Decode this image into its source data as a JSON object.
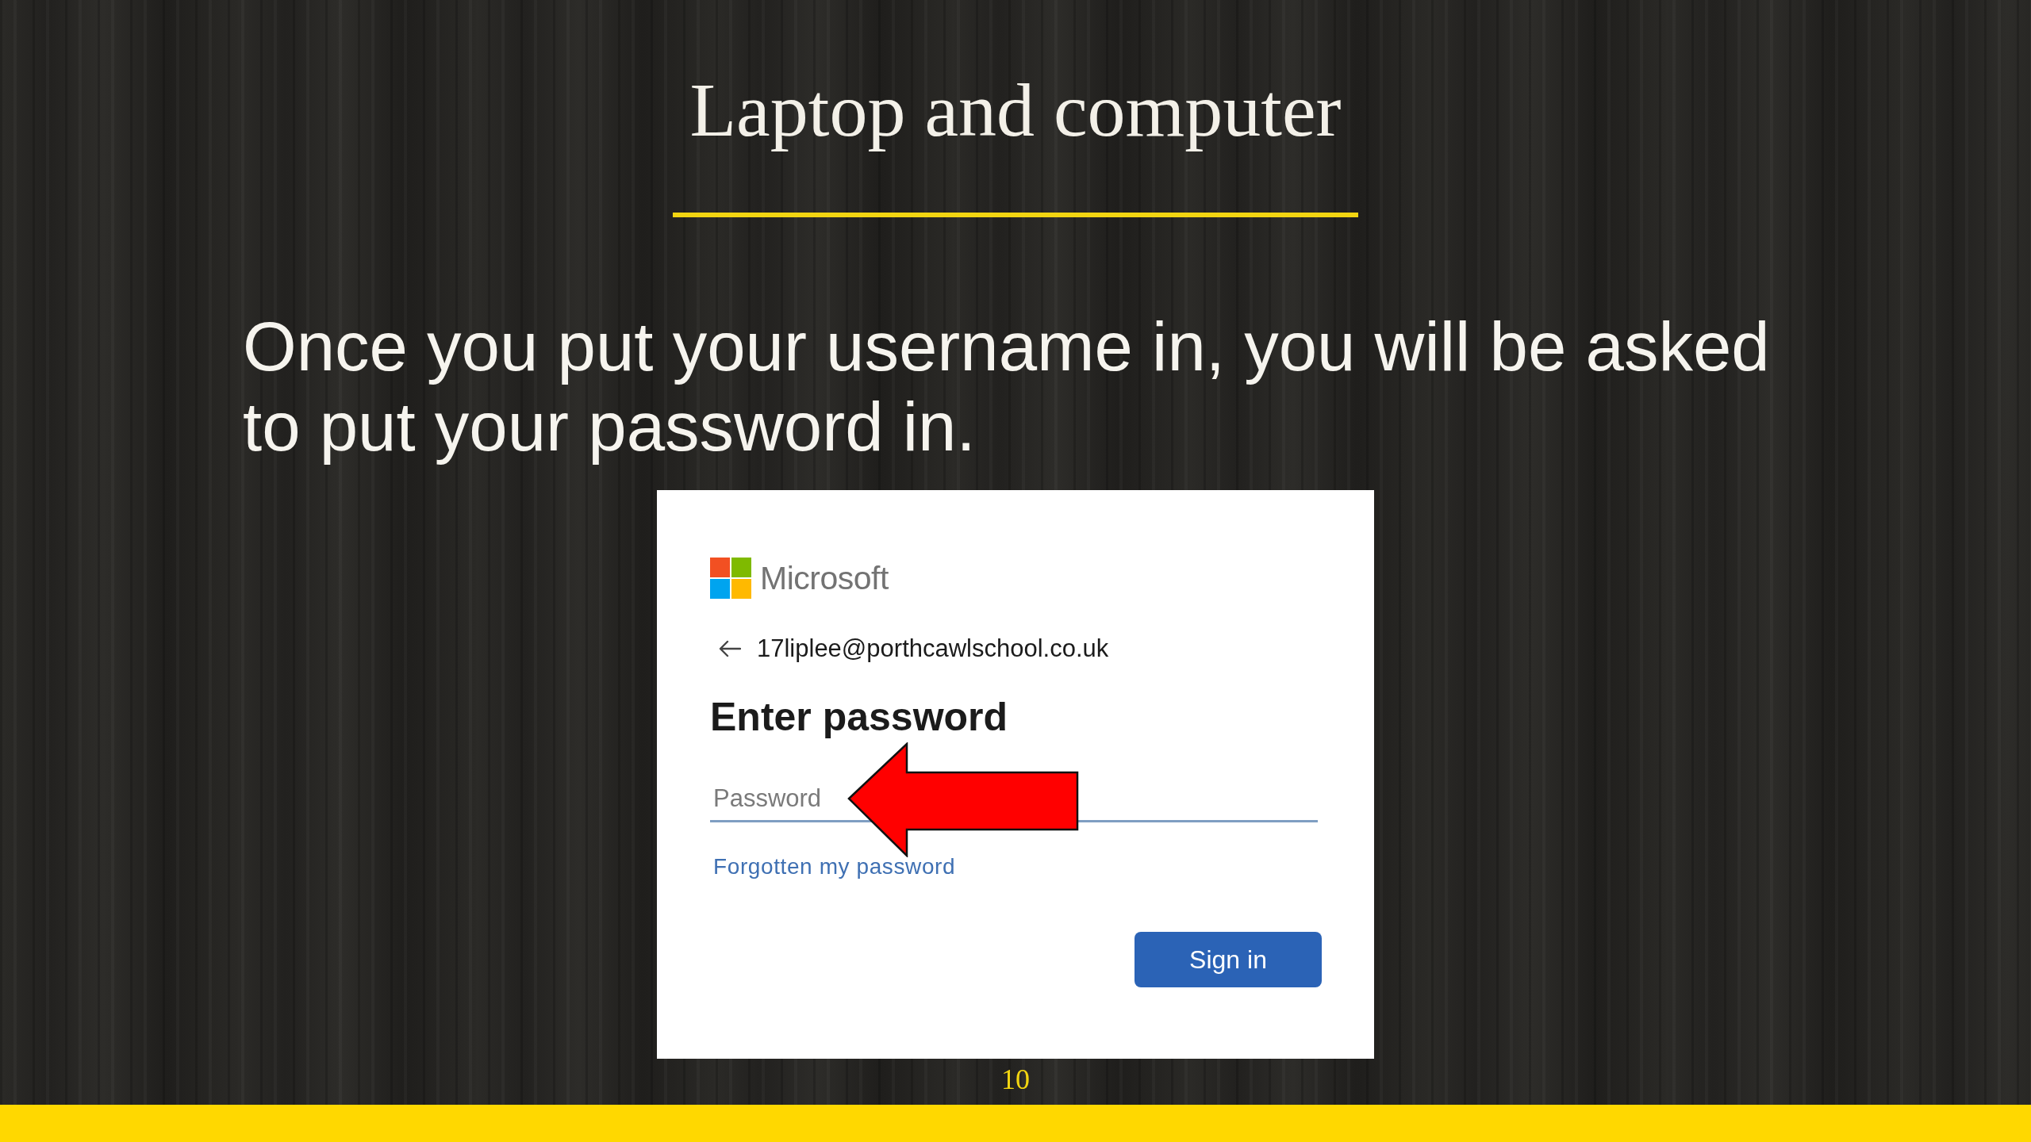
{
  "slide": {
    "title": "Laptop and computer",
    "body": "Once you put your username in, you will be asked to put your password in.",
    "page_number": "10"
  },
  "sign_in_screenshot": {
    "brand": "Microsoft",
    "account": "17liplee@porthcawlschool.co.uk",
    "heading": "Enter password",
    "password_field": {
      "placeholder": "Password"
    },
    "link": "Forgotten my password",
    "buttons": [
      "Sign in"
    ]
  }
}
